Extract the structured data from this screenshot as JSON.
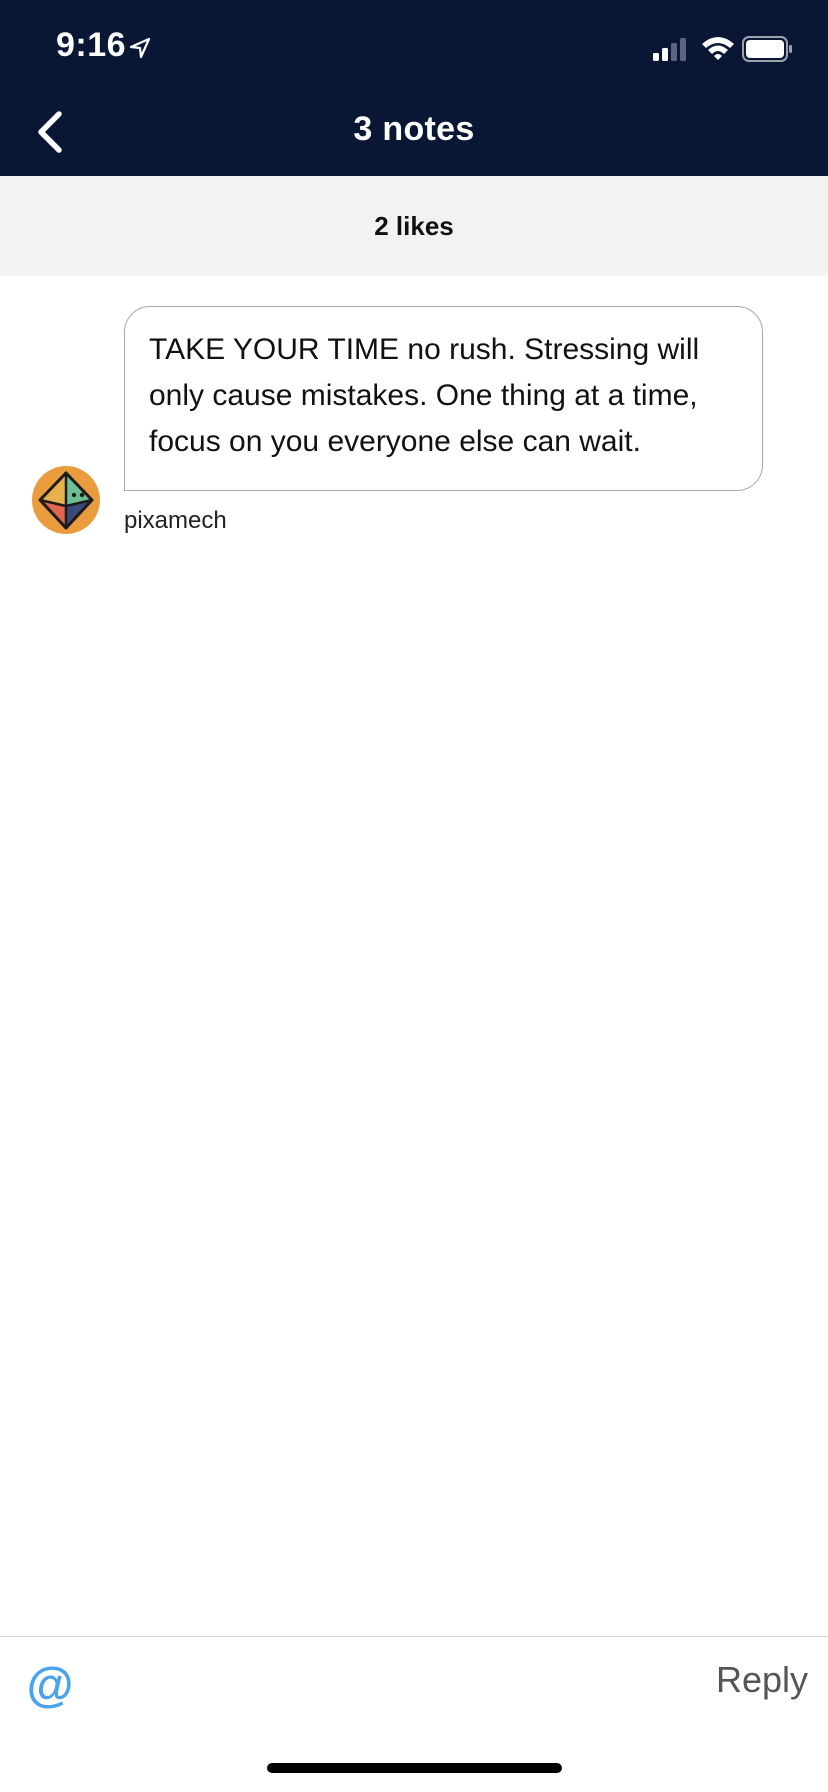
{
  "status_bar": {
    "time": "9:16",
    "icons": [
      "location-arrow-icon",
      "cellular-signal-icon",
      "wifi-icon",
      "battery-icon"
    ]
  },
  "nav": {
    "title": "3 notes",
    "back_icon": "chevron-left-icon"
  },
  "likes": {
    "label": "2 likes"
  },
  "notes": [
    {
      "text": "TAKE YOUR TIME no rush. Stressing will only cause mistakes. One thing at a time, focus on you everyone else can wait.",
      "username": "pixamech",
      "avatar_icon": "octahedron-avatar-icon"
    }
  ],
  "reply_bar": {
    "mention_label": "@",
    "reply_label": "Reply"
  },
  "colors": {
    "header_bg": "#091735",
    "likes_bg": "#f2f2f2",
    "mention_accent": "#4aa3ec",
    "avatar_bg": "#e89c3e"
  }
}
